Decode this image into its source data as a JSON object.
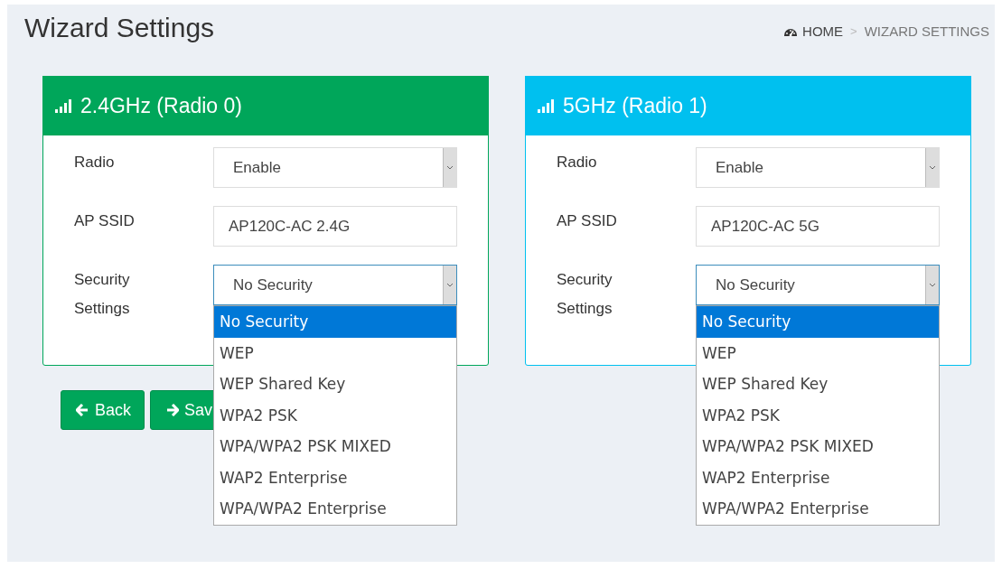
{
  "page": {
    "title": "Wizard Settings",
    "breadcrumb": [
      {
        "label": "HOME",
        "kind": "home"
      },
      {
        "label": "WIZARD SETTINGS",
        "kind": "current"
      }
    ],
    "breadcrumb_separator": ">"
  },
  "panels": [
    {
      "title": "2.4GHz (Radio 0)",
      "color": "#00a65a",
      "fields": [
        {
          "label": "Radio",
          "kind": "select",
          "value": "Enable",
          "expanded": false
        },
        {
          "label": "AP SSID",
          "kind": "text",
          "value": "AP120C-AC 2.4G"
        },
        {
          "label": "Security Settings",
          "kind": "select",
          "value": "No Security",
          "expanded": true,
          "options": [
            {
              "label": "No Security",
              "selected": true
            },
            {
              "label": "WEP",
              "selected": false
            },
            {
              "label": "WEP Shared Key",
              "selected": false
            },
            {
              "label": "WPA2 PSK",
              "selected": false
            },
            {
              "label": "WPA/WPA2 PSK MIXED",
              "selected": false
            },
            {
              "label": "WAP2 Enterprise",
              "selected": false
            },
            {
              "label": "WPA/WPA2 Enterprise",
              "selected": false
            }
          ]
        }
      ]
    },
    {
      "title": "5GHz (Radio 1)",
      "color": "#00c0ef",
      "fields": [
        {
          "label": "Radio",
          "kind": "select",
          "value": "Enable",
          "expanded": false
        },
        {
          "label": "AP SSID",
          "kind": "text",
          "value": "AP120C-AC 5G"
        },
        {
          "label": "Security Settings",
          "kind": "select",
          "value": "No Security",
          "expanded": true,
          "options": [
            {
              "label": "No Security",
              "selected": true
            },
            {
              "label": "WEP",
              "selected": false
            },
            {
              "label": "WEP Shared Key",
              "selected": false
            },
            {
              "label": "WPA2 PSK",
              "selected": false
            },
            {
              "label": "WPA/WPA2 PSK MIXED",
              "selected": false
            },
            {
              "label": "WAP2 Enterprise",
              "selected": false
            },
            {
              "label": "WPA/WPA2 Enterprise",
              "selected": false
            }
          ]
        }
      ]
    }
  ],
  "buttons": [
    {
      "label": "Back",
      "kind": "back"
    },
    {
      "label": "Sav",
      "kind": "save"
    }
  ]
}
